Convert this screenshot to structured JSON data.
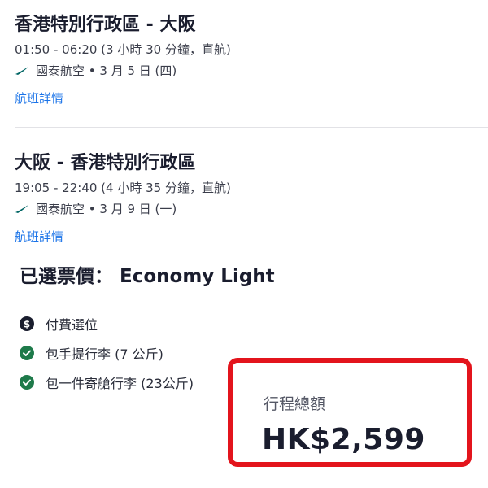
{
  "flights": [
    {
      "route": "香港特別行政區 - 大阪",
      "time": "01:50 - 06:20 (3 小時 30 分鐘，直航)",
      "airline": "國泰航空 • 3 月 5 日 (四)",
      "details_link": "航班詳情"
    },
    {
      "route": "大阪 - 香港特別行政區",
      "time": "19:05 - 22:40 (4 小時 35 分鐘，直航)",
      "airline": "國泰航空 • 3 月 9 日 (一)",
      "details_link": "航班詳情"
    }
  ],
  "fare": {
    "heading": "已選票價： Economy Light",
    "features": [
      {
        "label": "付費選位",
        "icon": "dollar-circle-icon",
        "color": "#1a1d2e"
      },
      {
        "label": "包手提行李 (7 公斤)",
        "icon": "check-circle-icon",
        "color": "#1e7a4a"
      },
      {
        "label": "包一件寄艙行李 (23公斤)",
        "icon": "check-circle-icon",
        "color": "#1e7a4a"
      }
    ]
  },
  "total": {
    "label": "行程總額",
    "price": "HK$2,599"
  },
  "colors": {
    "link": "#1a73e8",
    "highlight_border": "#e3141c",
    "airline_logo": "#006564"
  }
}
